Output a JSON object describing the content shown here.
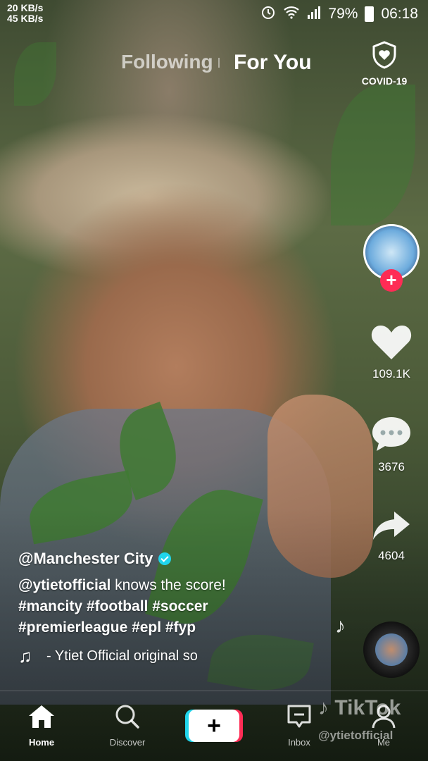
{
  "status_bar": {
    "upload_speed": "20 KB/s",
    "download_speed": "45 KB/s",
    "battery_percent": "79%",
    "time": "06:18"
  },
  "top_tabs": {
    "following": "Following",
    "for_you": "For You",
    "active": "For You"
  },
  "covid": {
    "label": "COVID-19",
    "icon": "shield-heart-icon"
  },
  "actions": {
    "likes": "109.1K",
    "comments": "3676",
    "shares": "4604"
  },
  "caption": {
    "username": "@Manchester City",
    "mention": "@ytietofficial",
    "text_after_mention": " knows the score!",
    "hashtags_line1": "#mancity #football #soccer",
    "hashtags_line2": "#premierleague #epl #fyp"
  },
  "music": {
    "text": "- Ytiet Official    original so"
  },
  "bottom_nav": {
    "home": "Home",
    "discover": "Discover",
    "inbox": "Inbox",
    "me": "Me",
    "active": "Home"
  },
  "watermark": {
    "brand": "TikTok",
    "user": "@ytietofficial"
  },
  "colors": {
    "accent_pink": "#fe2c55",
    "accent_cyan": "#20d5ec"
  }
}
